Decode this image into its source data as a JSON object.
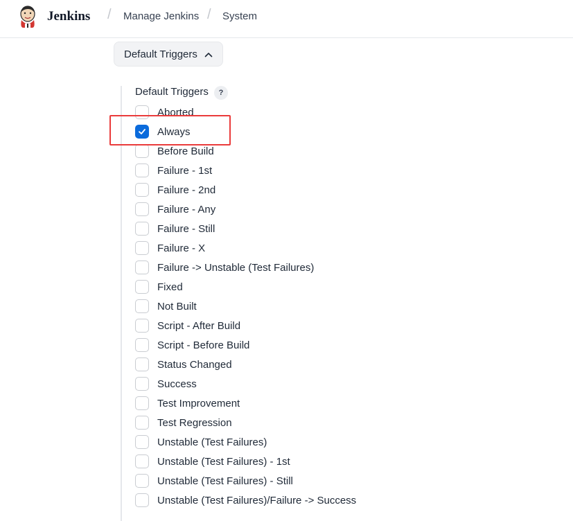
{
  "header": {
    "brand": "Jenkins",
    "breadcrumbs": [
      "Manage Jenkins",
      "System"
    ],
    "separator": "/"
  },
  "section": {
    "toggle_label": "Default Triggers",
    "group_title": "Default Triggers",
    "help_label": "?"
  },
  "triggers": [
    {
      "label": "Aborted",
      "checked": false
    },
    {
      "label": "Always",
      "checked": true
    },
    {
      "label": "Before Build",
      "checked": false
    },
    {
      "label": "Failure - 1st",
      "checked": false
    },
    {
      "label": "Failure - 2nd",
      "checked": false
    },
    {
      "label": "Failure - Any",
      "checked": false
    },
    {
      "label": "Failure - Still",
      "checked": false
    },
    {
      "label": "Failure - X",
      "checked": false
    },
    {
      "label": "Failure -> Unstable (Test Failures)",
      "checked": false
    },
    {
      "label": "Fixed",
      "checked": false
    },
    {
      "label": "Not Built",
      "checked": false
    },
    {
      "label": "Script - After Build",
      "checked": false
    },
    {
      "label": "Script - Before Build",
      "checked": false
    },
    {
      "label": "Status Changed",
      "checked": false
    },
    {
      "label": "Success",
      "checked": false
    },
    {
      "label": "Test Improvement",
      "checked": false
    },
    {
      "label": "Test Regression",
      "checked": false
    },
    {
      "label": "Unstable (Test Failures)",
      "checked": false
    },
    {
      "label": "Unstable (Test Failures) - 1st",
      "checked": false
    },
    {
      "label": "Unstable (Test Failures) - Still",
      "checked": false
    },
    {
      "label": "Unstable (Test Failures)/Failure -> Success",
      "checked": false
    }
  ],
  "colors": {
    "checkbox_checked": "#0b6bdc",
    "highlight_border": "#ea3a3a"
  }
}
